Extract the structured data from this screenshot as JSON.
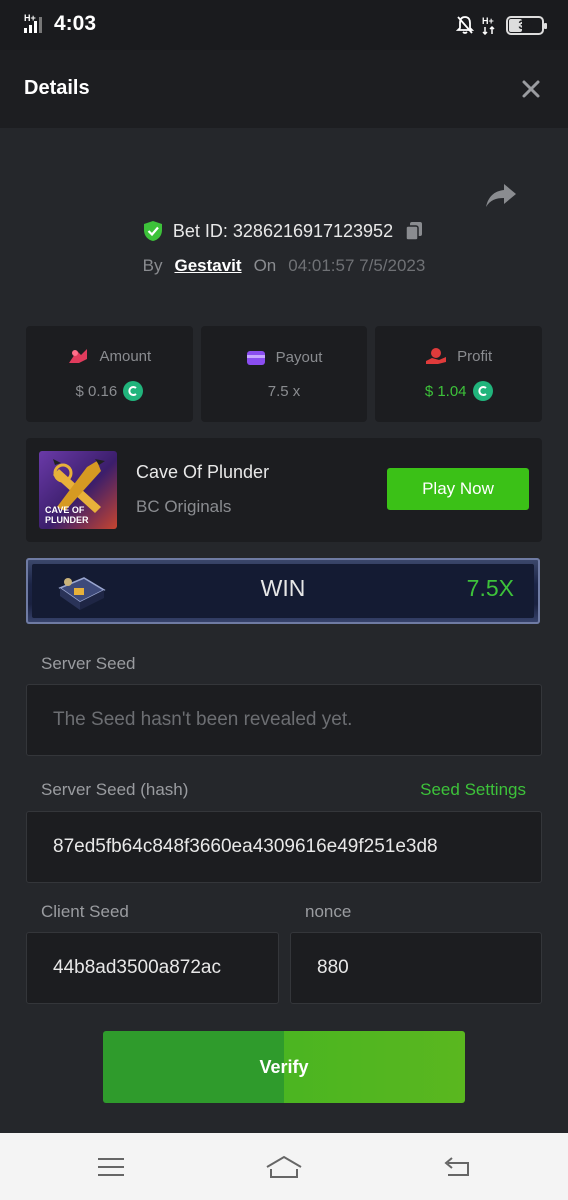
{
  "status_bar": {
    "time": "4:03",
    "battery": "39"
  },
  "header": {
    "title": "Details"
  },
  "bet": {
    "id_label": "Bet ID: 3286216917123952",
    "by_label": "By",
    "user": "Gestavit",
    "on_label": "On",
    "timestamp": "04:01:57 7/5/2023"
  },
  "stats": {
    "amount": {
      "label": "Amount",
      "value": "$ 0.16"
    },
    "payout": {
      "label": "Payout",
      "value": "7.5 x"
    },
    "profit": {
      "label": "Profit",
      "value": "$ 1.04"
    }
  },
  "game": {
    "name": "Cave Of Plunder",
    "provider": "BC Originals",
    "thumb_text": "CAVE OF PLUNDER",
    "play_label": "Play Now"
  },
  "result": {
    "label": "WIN",
    "multiplier": "7.5X"
  },
  "seeds": {
    "server_seed_label": "Server Seed",
    "server_seed_value": "The Seed hasn't been revealed yet.",
    "server_hash_label": "Server Seed (hash)",
    "seed_settings_label": "Seed Settings",
    "server_hash_value": "87ed5fb64c848f3660ea4309616e49f251e3d8",
    "client_seed_label": "Client Seed",
    "client_seed_value": "44b8ad3500a872ac",
    "nonce_label": "nonce",
    "nonce_value": "880"
  },
  "verify_label": "Verify",
  "colors": {
    "accent_green": "#3dc23a",
    "background": "#25272b",
    "panel": "#1c1d20"
  }
}
